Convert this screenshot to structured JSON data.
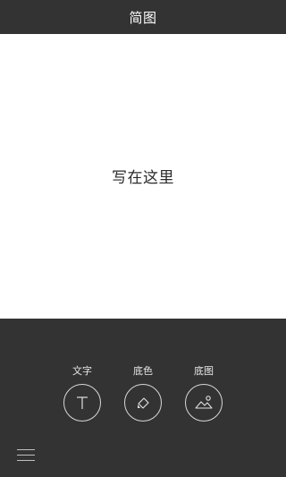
{
  "header": {
    "title": "简图"
  },
  "canvas": {
    "placeholder": "写在这里"
  },
  "toolbar": {
    "tools": [
      {
        "label": "文字",
        "icon": "text-icon"
      },
      {
        "label": "底色",
        "icon": "fill-bucket-icon"
      },
      {
        "label": "底图",
        "icon": "image-icon"
      }
    ]
  },
  "menu": {
    "icon": "hamburger-menu-icon"
  },
  "colors": {
    "background": "#333333",
    "canvas": "#ffffff",
    "accent_line": "#d8d8d8"
  }
}
